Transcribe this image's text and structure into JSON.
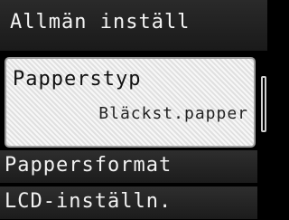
{
  "header": {
    "title": "Allmän inställ"
  },
  "menu": {
    "items": [
      {
        "label": "Papperstyp",
        "value": "Bläckst.papper"
      },
      {
        "label": "Pappersformat"
      },
      {
        "label": "LCD-inställn."
      }
    ]
  }
}
